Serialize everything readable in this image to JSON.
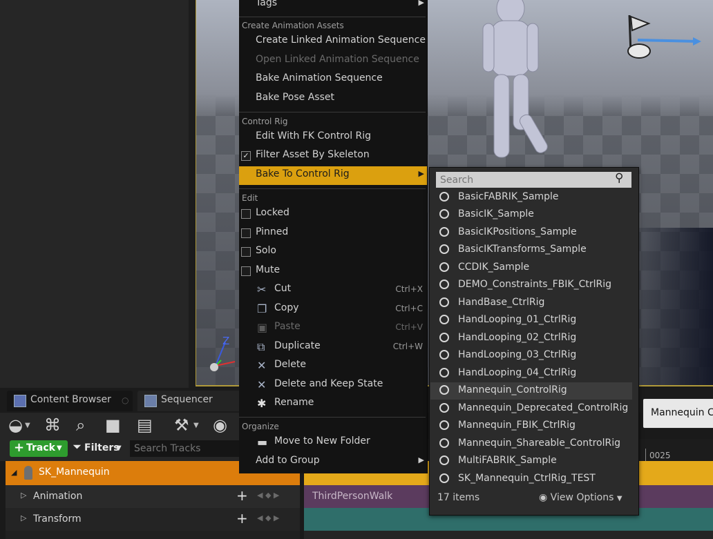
{
  "context_menu": {
    "top_item": {
      "label": "Tags"
    },
    "sections": [
      {
        "header": "Create Animation Assets",
        "items": [
          {
            "label": "Create Linked Animation Sequence",
            "disabled": false
          },
          {
            "label": "Open Linked Animation Sequence",
            "disabled": true
          },
          {
            "label": "Bake Animation Sequence",
            "disabled": false
          },
          {
            "label": "Bake Pose Asset",
            "disabled": false
          }
        ]
      },
      {
        "header": "Control Rig",
        "items": [
          {
            "label": "Edit With FK Control Rig"
          },
          {
            "label": "Filter Asset By Skeleton",
            "checked": true
          },
          {
            "label": "Bake To Control Rig",
            "submenu": true,
            "active": true
          }
        ]
      },
      {
        "header": "Edit",
        "items": [
          {
            "label": "Locked",
            "checked": false
          },
          {
            "label": "Pinned",
            "checked": false
          },
          {
            "label": "Solo",
            "checked": false
          },
          {
            "label": "Mute",
            "checked": false
          },
          {
            "label": "Cut",
            "shortcut": "Ctrl+X",
            "icon": "scissors-icon"
          },
          {
            "label": "Copy",
            "shortcut": "Ctrl+C",
            "icon": "copy-icon"
          },
          {
            "label": "Paste",
            "shortcut": "Ctrl+V",
            "icon": "paste-icon",
            "disabled": true
          },
          {
            "label": "Duplicate",
            "shortcut": "Ctrl+W",
            "icon": "duplicate-icon"
          },
          {
            "label": "Delete",
            "icon": "x-icon"
          },
          {
            "label": "Delete and Keep State",
            "icon": "x-icon"
          },
          {
            "label": "Rename",
            "icon": "asterisk-icon"
          }
        ]
      },
      {
        "header": "Organize",
        "items": [
          {
            "label": "Move to New Folder",
            "icon": "folder-icon"
          },
          {
            "label": "Add to Group",
            "submenu": true
          }
        ]
      }
    ]
  },
  "submenu": {
    "search_placeholder": "Search",
    "items": [
      "BasicFABRIK_Sample",
      "BasicIK_Sample",
      "BasicIKPositions_Sample",
      "BasicIKTransforms_Sample",
      "CCDIK_Sample",
      "DEMO_Constraints_FBIK_CtrlRig",
      "HandBase_CtrlRig",
      "HandLooping_01_CtrlRig",
      "HandLooping_02_CtrlRig",
      "HandLooping_03_CtrlRig",
      "HandLooping_04_CtrlRig",
      "Mannequin_ControlRig",
      "Mannequin_Deprecated_ControlRig",
      "Mannequin_FBIK_CtrlRig",
      "Mannequin_Shareable_ControlRig",
      "MultiFABRIK_Sample",
      "SK_Mannequin_CtrlRig_TEST"
    ],
    "hovered_index": 11,
    "item_count": "17 items",
    "view_options": "View Options"
  },
  "tabs": {
    "content_browser": "Content Browser",
    "sequencer": "Sequencer"
  },
  "sequencer": {
    "track_button": "Track",
    "filters_button": "Filters",
    "search_placeholder": "Search Tracks",
    "tracks": [
      {
        "label": "SK_Mannequin",
        "color": "#dc7d0c"
      },
      {
        "label": "Animation"
      },
      {
        "label": "Transform"
      }
    ],
    "timeline_frame": "0025",
    "section_label": "ThirdPersonWalk"
  },
  "viewport": {
    "axis_label": "Z"
  },
  "side_button": "Mannequin C",
  "colors": {
    "accent": "#dba00f",
    "track_green": "#2e9c2e"
  }
}
